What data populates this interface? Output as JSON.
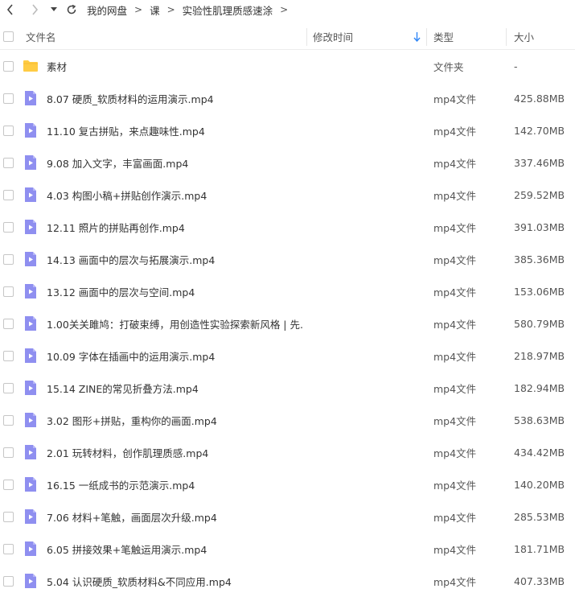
{
  "breadcrumbs": [
    "我的网盘",
    "课",
    "实验性肌理质感速涂"
  ],
  "breadcrumb_separator": ">",
  "columns": {
    "name": "文件名",
    "modified": "修改时间",
    "type": "类型",
    "size": "大小"
  },
  "files": [
    {
      "name": "素材",
      "type": "文件夹",
      "size": "-",
      "icon": "folder-icon"
    },
    {
      "name": "8.07 硬质_软质材料的运用演示.mp4",
      "type": "mp4文件",
      "size": "425.88MB",
      "icon": "video-file-icon"
    },
    {
      "name": "11.10 复古拼贴，来点趣味性.mp4",
      "type": "mp4文件",
      "size": "142.70MB",
      "icon": "video-file-icon"
    },
    {
      "name": "9.08 加入文字，丰富画面.mp4",
      "type": "mp4文件",
      "size": "337.46MB",
      "icon": "video-file-icon"
    },
    {
      "name": "4.03 构图小稿+拼贴创作演示.mp4",
      "type": "mp4文件",
      "size": "259.52MB",
      "icon": "video-file-icon"
    },
    {
      "name": "12.11 照片的拼贴再创作.mp4",
      "type": "mp4文件",
      "size": "391.03MB",
      "icon": "video-file-icon"
    },
    {
      "name": "14.13 画面中的层次与拓展演示.mp4",
      "type": "mp4文件",
      "size": "385.36MB",
      "icon": "video-file-icon"
    },
    {
      "name": "13.12 画面中的层次与空间.mp4",
      "type": "mp4文件",
      "size": "153.06MB",
      "icon": "video-file-icon"
    },
    {
      "name": "1.00关关雎鸠：打破束缚，用创造性实验探索新风格 | 先...",
      "type": "mp4文件",
      "size": "580.79MB",
      "icon": "video-file-icon"
    },
    {
      "name": "10.09 字体在插画中的运用演示.mp4",
      "type": "mp4文件",
      "size": "218.97MB",
      "icon": "video-file-icon"
    },
    {
      "name": "15.14 ZINE的常见折叠方法.mp4",
      "type": "mp4文件",
      "size": "182.94MB",
      "icon": "video-file-icon"
    },
    {
      "name": "3.02 图形+拼贴，重构你的画面.mp4",
      "type": "mp4文件",
      "size": "538.63MB",
      "icon": "video-file-icon"
    },
    {
      "name": "2.01 玩转材料，创作肌理质感.mp4",
      "type": "mp4文件",
      "size": "434.42MB",
      "icon": "video-file-icon"
    },
    {
      "name": "16.15 一纸成书的示范演示.mp4",
      "type": "mp4文件",
      "size": "140.20MB",
      "icon": "video-file-icon"
    },
    {
      "name": "7.06 材料+笔触，画面层次升级.mp4",
      "type": "mp4文件",
      "size": "285.53MB",
      "icon": "video-file-icon"
    },
    {
      "name": "6.05 拼接效果+笔触运用演示.mp4",
      "type": "mp4文件",
      "size": "181.71MB",
      "icon": "video-file-icon"
    },
    {
      "name": "5.04 认识硬质_软质材料&不同应用.mp4",
      "type": "mp4文件",
      "size": "407.33MB",
      "icon": "video-file-icon"
    }
  ],
  "colors": {
    "folder": "#ffcc44",
    "video_icon": "#8f8ff0",
    "sort_arrow": "#2f86f6"
  }
}
